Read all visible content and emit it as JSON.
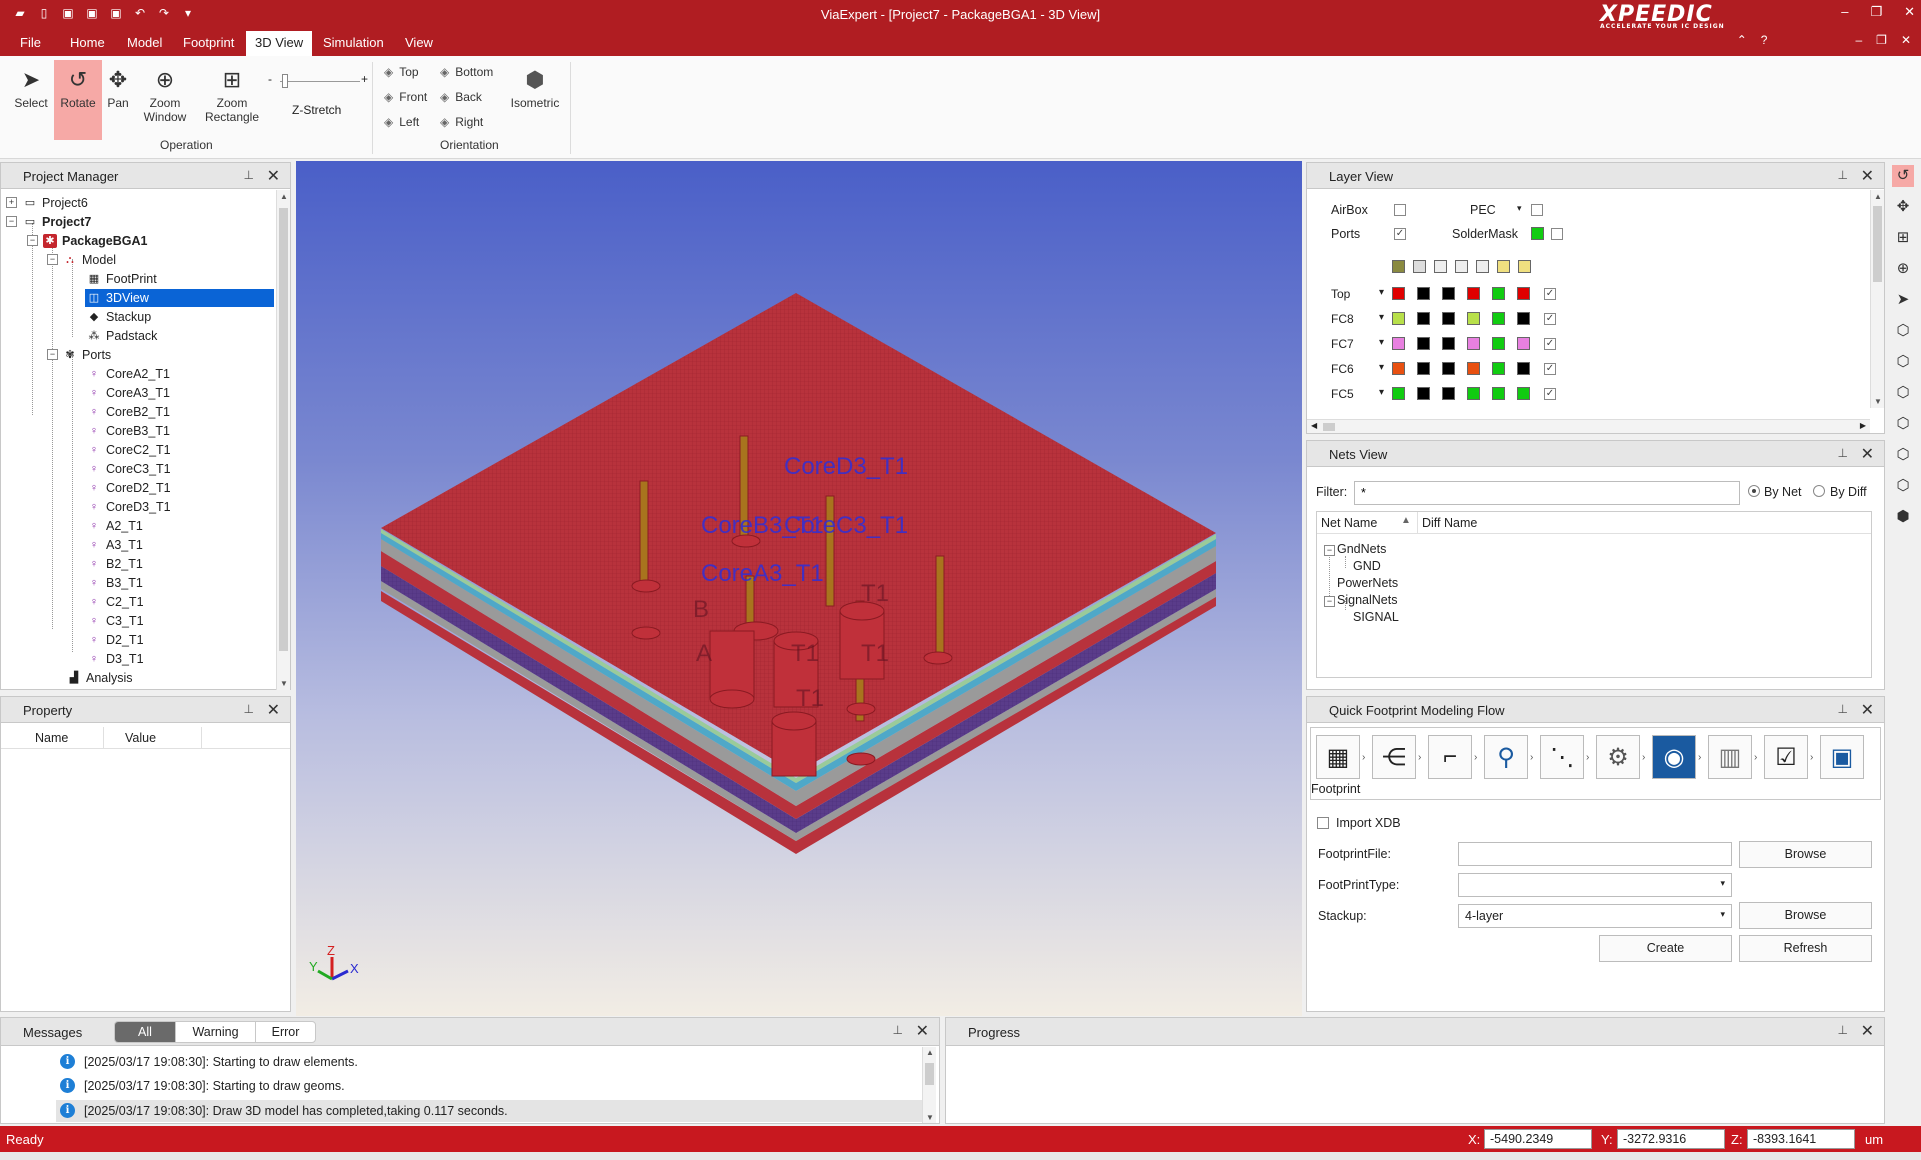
{
  "window": {
    "title": "ViaExpert - [Project7 - PackageBGA1 - 3D View]",
    "brand": "XPEEDIC",
    "brand_tagline": "ACCELERATE YOUR IC DESIGN"
  },
  "menu": {
    "tabs": [
      "File",
      "Home",
      "Model",
      "Footprint",
      "3D View",
      "Simulation",
      "View"
    ],
    "active_tab": "3D View"
  },
  "ribbon": {
    "operation": {
      "select": "Select",
      "rotate": "Rotate",
      "pan": "Pan",
      "zoom_window_1": "Zoom",
      "zoom_window_2": "Window",
      "zoom_rect_1": "Zoom",
      "zoom_rect_2": "Rectangle",
      "zstretch": "Z-Stretch",
      "zstretch_minus": "-",
      "zstretch_plus": "+",
      "group_label": "Operation"
    },
    "orientation": {
      "top": "Top",
      "bottom": "Bottom",
      "front": "Front",
      "back": "Back",
      "left": "Left",
      "right": "Right",
      "isometric": "Isometric",
      "group_label": "Orientation"
    }
  },
  "project_manager": {
    "title": "Project Manager",
    "nodes": {
      "project6": "Project6",
      "project7": "Project7",
      "package": "PackageBGA1",
      "model": "Model",
      "footprint": "FootPrint",
      "view3d": "3DView",
      "stackup": "Stackup",
      "padstack": "Padstack",
      "ports": "Ports",
      "analysis": "Analysis"
    },
    "ports": [
      "CoreA2_T1",
      "CoreA3_T1",
      "CoreB2_T1",
      "CoreB3_T1",
      "CoreC2_T1",
      "CoreC3_T1",
      "CoreD2_T1",
      "CoreD3_T1",
      "A2_T1",
      "A3_T1",
      "B2_T1",
      "B3_T1",
      "C2_T1",
      "C3_T1",
      "D2_T1",
      "D3_T1"
    ]
  },
  "property": {
    "title": "Property",
    "col_name": "Name",
    "col_value": "Value"
  },
  "viewport": {
    "labels": {
      "d3": "CoreD3_T1",
      "b3": "CoreB3_T1",
      "c3": "CoreC3_T1",
      "a3": "CoreA3_T1",
      "d2": "T1",
      "b2": "B",
      "a2": "A",
      "c2": "T1",
      "x2": "T1",
      "small": "T1"
    },
    "axes": {
      "x": "X",
      "y": "Y",
      "z": "Z"
    }
  },
  "layer_view": {
    "title": "Layer View",
    "airbox": "AirBox",
    "pec": "PEC",
    "ports": "Ports",
    "soldermask": "SolderMask",
    "layers": [
      {
        "name": "Top",
        "colors": [
          "#e00000",
          "#000000",
          "#000000",
          "#e00000",
          "#11cc11",
          "#e00000"
        ]
      },
      {
        "name": "FC8",
        "colors": [
          "#b8e04a",
          "#000000",
          "#000000",
          "#b8e04a",
          "#11cc11",
          "#000000"
        ]
      },
      {
        "name": "FC7",
        "colors": [
          "#e880e0",
          "#000000",
          "#000000",
          "#e880e0",
          "#11cc11",
          "#e880e0"
        ]
      },
      {
        "name": "FC6",
        "colors": [
          "#e85010",
          "#000000",
          "#000000",
          "#e85010",
          "#11cc11",
          "#000000"
        ]
      },
      {
        "name": "FC5",
        "colors": [
          "#11cc11",
          "#000000",
          "#000000",
          "#11cc11",
          "#11cc11",
          "#11cc11"
        ]
      }
    ]
  },
  "nets_view": {
    "title": "Nets View",
    "filter_label": "Filter:",
    "filter_value": "*",
    "by_net": "By Net",
    "by_diff": "By Diff",
    "col_net": "Net Name",
    "col_diff": "Diff Name",
    "tree": {
      "gndnets": "GndNets",
      "gnd": "GND",
      "powernets": "PowerNets",
      "signalnets": "SignalNets",
      "signal": "SIGNAL"
    }
  },
  "qfmf": {
    "title": "Quick Footprint Modeling Flow",
    "step_label": "Footprint",
    "import_xdb": "Import XDB",
    "footprint_file": "FootprintFile:",
    "footprint_type": "FootPrintType:",
    "stackup": "Stackup:",
    "stackup_value": "4-layer",
    "browse": "Browse",
    "create": "Create",
    "refresh": "Refresh"
  },
  "messages": {
    "title": "Messages",
    "filters": [
      "All",
      "Warning",
      "Error"
    ],
    "active_filter": "All",
    "rows": [
      "[2025/03/17 19:08:30]: Starting to draw elements.",
      "[2025/03/17 19:08:30]: Starting to draw geoms.",
      "[2025/03/17 19:08:30]: Draw 3D model has completed,taking 0.117 seconds."
    ]
  },
  "progress": {
    "title": "Progress"
  },
  "status": {
    "ready": "Ready",
    "x_label": "X:",
    "x_value": "-5490.2349",
    "y_label": "Y:",
    "y_value": "-3272.9316",
    "z_label": "Z:",
    "z_value": "-8393.1641",
    "unit": "um"
  },
  "colors": {
    "brand_red": "#b01d22",
    "status_red": "#c8181f",
    "selection_blue": "#0a64d6",
    "board_red": "#b8323c"
  }
}
